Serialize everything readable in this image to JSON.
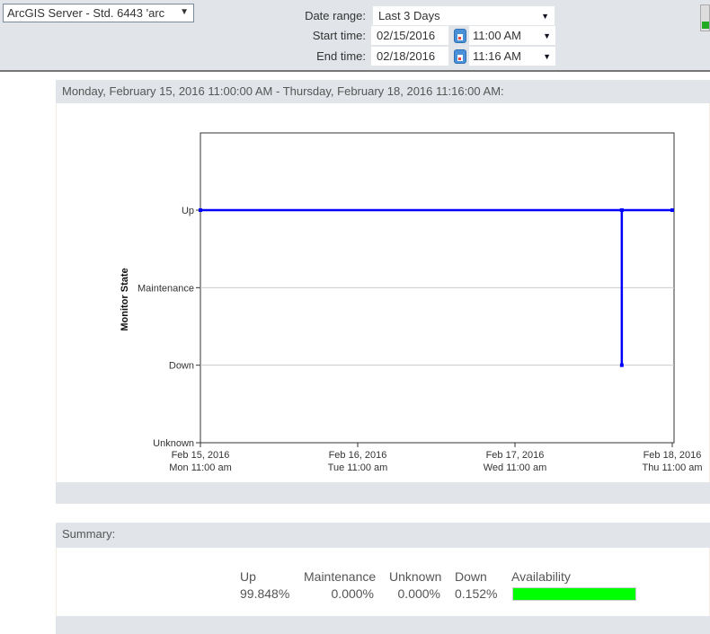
{
  "toolbar": {
    "monitor_select": "ArcGIS Server - Std. 6443 'arc",
    "date_range_label": "Date range:",
    "date_range_value": "Last 3 Days",
    "start_label": "Start time:",
    "start_date": "02/15/2016",
    "start_time": "11:00 AM",
    "end_label": "End time:",
    "end_date": "02/18/2016",
    "end_time": "11:16 AM"
  },
  "chart_panel": {
    "header": "Monday, February 15, 2016 11:00:00 AM - Thursday, February 18, 2016 11:16:00 AM:"
  },
  "chart_data": {
    "type": "line",
    "ylabel": "Monitor State",
    "y_categories": [
      "Unknown",
      "Down",
      "Maintenance",
      "Up"
    ],
    "x_ticks": [
      {
        "value": "2016-02-15 11:00",
        "line1": "Feb 15, 2016",
        "line2": "Mon 11:00 am"
      },
      {
        "value": "2016-02-16 11:00",
        "line1": "Feb 16, 2016",
        "line2": "Tue 11:00 am"
      },
      {
        "value": "2016-02-17 11:00",
        "line1": "Feb 17, 2016",
        "line2": "Wed 11:00 am"
      },
      {
        "value": "2016-02-18 11:00",
        "line1": "Feb 18, 2016",
        "line2": "Thu 11:00 am"
      }
    ],
    "xlim": [
      "2016-02-15 11:00",
      "2016-02-18 11:00"
    ],
    "grid": true,
    "series": [
      {
        "color": "#0000ff",
        "points": [
          [
            "2016-02-15 11:00",
            "Up"
          ],
          [
            "2016-02-18 03:18",
            "Up"
          ],
          [
            "2016-02-18 03:18",
            "Down"
          ],
          [
            "2016-02-18 03:18",
            "Up"
          ],
          [
            "2016-02-18 11:00",
            "Up"
          ]
        ]
      }
    ]
  },
  "summary": {
    "header": "Summary:",
    "columns": [
      "Up",
      "Maintenance",
      "Unknown",
      "Down",
      "Availability"
    ],
    "values": [
      "99.848%",
      "0.000%",
      "0.000%",
      "0.152%"
    ],
    "availability_fraction": 0.99848,
    "availability_color": "#00ff00"
  }
}
